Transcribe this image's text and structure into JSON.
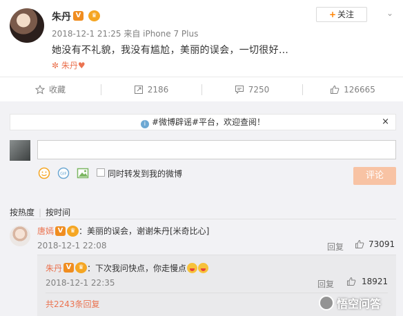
{
  "post": {
    "author": "朱丹",
    "meta": "2018-12-1 21:25 来自 iPhone 7 Plus",
    "content": "她没有不礼貌，我没有尴尬，美丽的误会，一切很好…",
    "tag": "✼ 朱丹♥",
    "follow_label": "关注",
    "follow_plus": "+",
    "verified_badge": "V"
  },
  "actions": {
    "favorite_label": "收藏",
    "repost_count": "2186",
    "comment_count": "7250",
    "like_count": "126665"
  },
  "comments": {
    "notice": "#微博辟谣#平台，欢迎查阅！",
    "notice_close": "×",
    "repost_label": "同时转发到我的微博",
    "submit_label": "评论",
    "sort_hot": "按热度",
    "sort_sep": "|",
    "sort_time": "按时间",
    "items": [
      {
        "name": "唐嫣",
        "text": "：美丽的误会，谢谢朱丹[米奇比心]",
        "time": "2018-12-1 22:08",
        "reply_label": "回复",
        "likes": "73091",
        "reply": {
          "name": "朱丹",
          "text": "：下次我问快点，你走慢点",
          "time": "2018-12-1 22:35",
          "reply_label": "回复",
          "likes": "18921"
        },
        "total_replies": "共2243条回复"
      }
    ]
  },
  "watermark": "悟空问答",
  "colors": {
    "accent": "#eb7350",
    "orange": "#ff8200",
    "bg_gray": "#f2f2f5"
  }
}
